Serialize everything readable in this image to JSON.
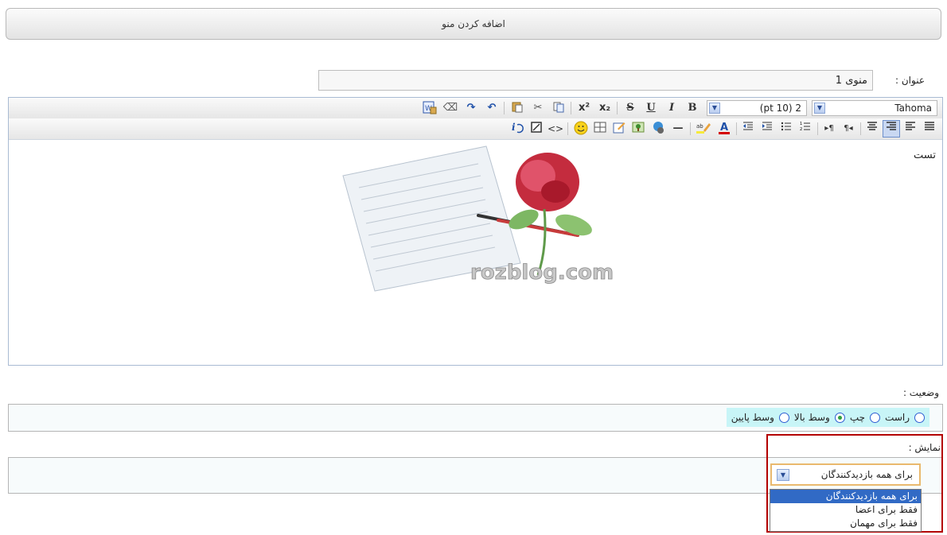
{
  "header": {
    "title": "اضافه کردن منو"
  },
  "title_field": {
    "label": "عنوان :",
    "value": "منوی 1"
  },
  "toolbar": {
    "font_name": "Tahoma",
    "font_size": "(pt 10) 2",
    "bold": "B",
    "italic": "I",
    "underline": "U",
    "strike": "S",
    "subscript": "x₂",
    "superscript": "x²",
    "row1_icons": [
      "bold-icon",
      "italic-icon",
      "underline-icon",
      "strikethrough-icon",
      "subscript-icon",
      "superscript-icon",
      "copy-icon",
      "cut-icon",
      "paste-icon",
      "undo-icon",
      "redo-icon",
      "eraser-icon",
      "paste-word-icon"
    ],
    "row2_icons": [
      "align-justify-icon",
      "align-left-icon",
      "align-center-icon",
      "align-right-icon",
      "ltr-icon",
      "rtl-icon",
      "ordered-list-icon",
      "unordered-list-icon",
      "outdent-icon",
      "indent-icon",
      "text-color-icon",
      "highlight-icon",
      "horizontal-rule-icon",
      "link-icon",
      "image-icon",
      "edit-icon",
      "table-icon",
      "smiley-icon",
      "source-code-icon",
      "maximize-icon",
      "about-icon"
    ]
  },
  "editor": {
    "text": "تست",
    "image_caption": "rozblog.com"
  },
  "status": {
    "label": "وضعیت :",
    "options": [
      "راست",
      "چپ",
      "وسط بالا",
      "وسط پایین"
    ],
    "selected_index": 1
  },
  "display": {
    "label": "نمایش :",
    "selected": "برای همه بازدیدکنندگان",
    "options": [
      "برای همه بازدیدکنندگان",
      "فقط برای اعضا",
      "فقط برای مهمان"
    ]
  },
  "colors": {
    "highlight": "#b30000",
    "accent": "#316ac5",
    "radio_bg": "#c8f5f7"
  }
}
